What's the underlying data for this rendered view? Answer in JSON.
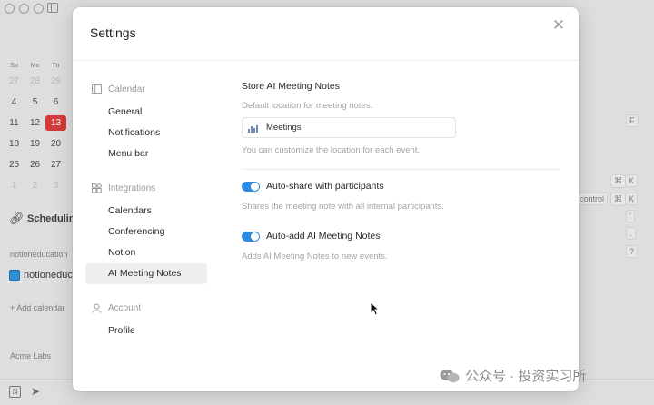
{
  "background": {
    "calendar": {
      "weekdays": [
        "Su",
        "Mo",
        "Tu"
      ],
      "rows": [
        [
          {
            "d": "27",
            "muted": true
          },
          {
            "d": "28",
            "muted": true
          },
          {
            "d": "29",
            "muted": true
          }
        ],
        [
          {
            "d": "4"
          },
          {
            "d": "5"
          },
          {
            "d": "6"
          }
        ],
        [
          {
            "d": "11"
          },
          {
            "d": "12"
          },
          {
            "d": "13",
            "today": true
          }
        ],
        [
          {
            "d": "18"
          },
          {
            "d": "19"
          },
          {
            "d": "20"
          }
        ],
        [
          {
            "d": "25"
          },
          {
            "d": "26"
          },
          {
            "d": "27"
          }
        ],
        [
          {
            "d": "1",
            "muted": true
          },
          {
            "d": "2",
            "muted": true
          },
          {
            "d": "3",
            "muted": true
          }
        ]
      ]
    },
    "scheduling_label": "Scheduling",
    "account_email": "notioneducation",
    "calendar_name": "notioneduc",
    "add_calendar": "+ Add calendar",
    "org_name": "Acme Labs",
    "keys": [
      "F",
      "⌘",
      "K",
      "control",
      "⌘",
      "K",
      "'",
      ".",
      "?"
    ]
  },
  "modal": {
    "title": "Settings",
    "nav": [
      {
        "section": "Calendar",
        "icon": "calendar-icon",
        "items": [
          "General",
          "Notifications",
          "Menu bar"
        ]
      },
      {
        "section": "Integrations",
        "icon": "integrations-icon",
        "items": [
          "Calendars",
          "Conferencing",
          "Notion",
          "AI Meeting Notes"
        ]
      },
      {
        "section": "Account",
        "icon": "person-icon",
        "items": [
          "Profile"
        ]
      }
    ],
    "active_item": "AI Meeting Notes",
    "content": {
      "store_title": "Store AI Meeting Notes",
      "store_desc": "Default location for meeting notes.",
      "location_value": "Meetings",
      "location_note": "You can customize the location for each event.",
      "auto_share_label": "Auto-share with participants",
      "auto_share_on": true,
      "auto_share_desc": "Shares the meeting note with all internal participants.",
      "auto_add_label": "Auto-add AI Meeting Notes",
      "auto_add_on": true,
      "auto_add_desc": "Adds AI Meeting Notes to new events."
    }
  },
  "watermark": "公众号 · 投资实习所",
  "colors": {
    "toggle_on": "#2f8be0",
    "today": "#d33b3b",
    "active_nav_bg": "#efefef"
  }
}
